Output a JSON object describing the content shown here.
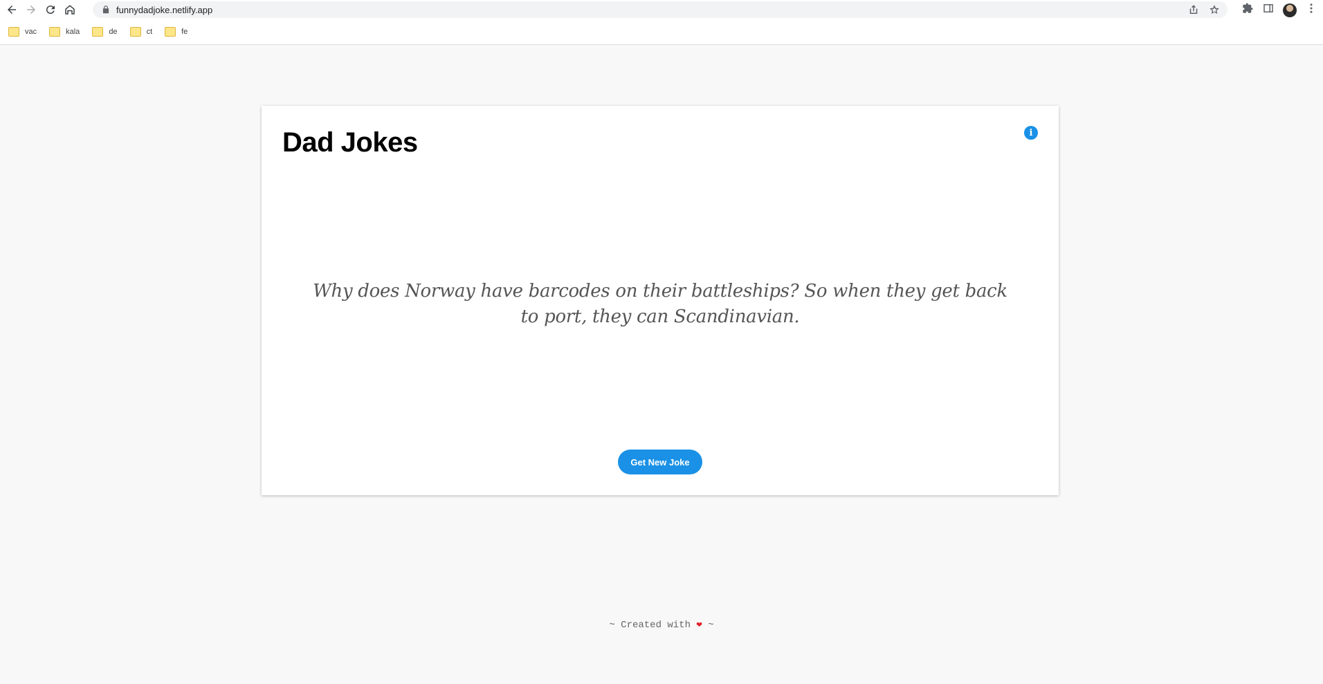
{
  "browser": {
    "url": "funnydadjoke.netlify.app",
    "bookmarks": [
      {
        "label": "vac"
      },
      {
        "label": "kala"
      },
      {
        "label": "de"
      },
      {
        "label": "ct"
      },
      {
        "label": "fe"
      }
    ]
  },
  "app": {
    "title": "Dad Jokes",
    "info_icon": "i",
    "joke": "Why does Norway have barcodes on their battleships? So when they get back to port, they can Scandinavian.",
    "new_joke_button": "Get New Joke"
  },
  "footer": {
    "prefix": "~ Created with ",
    "heart": "❤",
    "suffix": " ~"
  },
  "colors": {
    "accent": "#1a91e6",
    "page_bg": "#f8f8f8",
    "heart": "#e0202a"
  }
}
